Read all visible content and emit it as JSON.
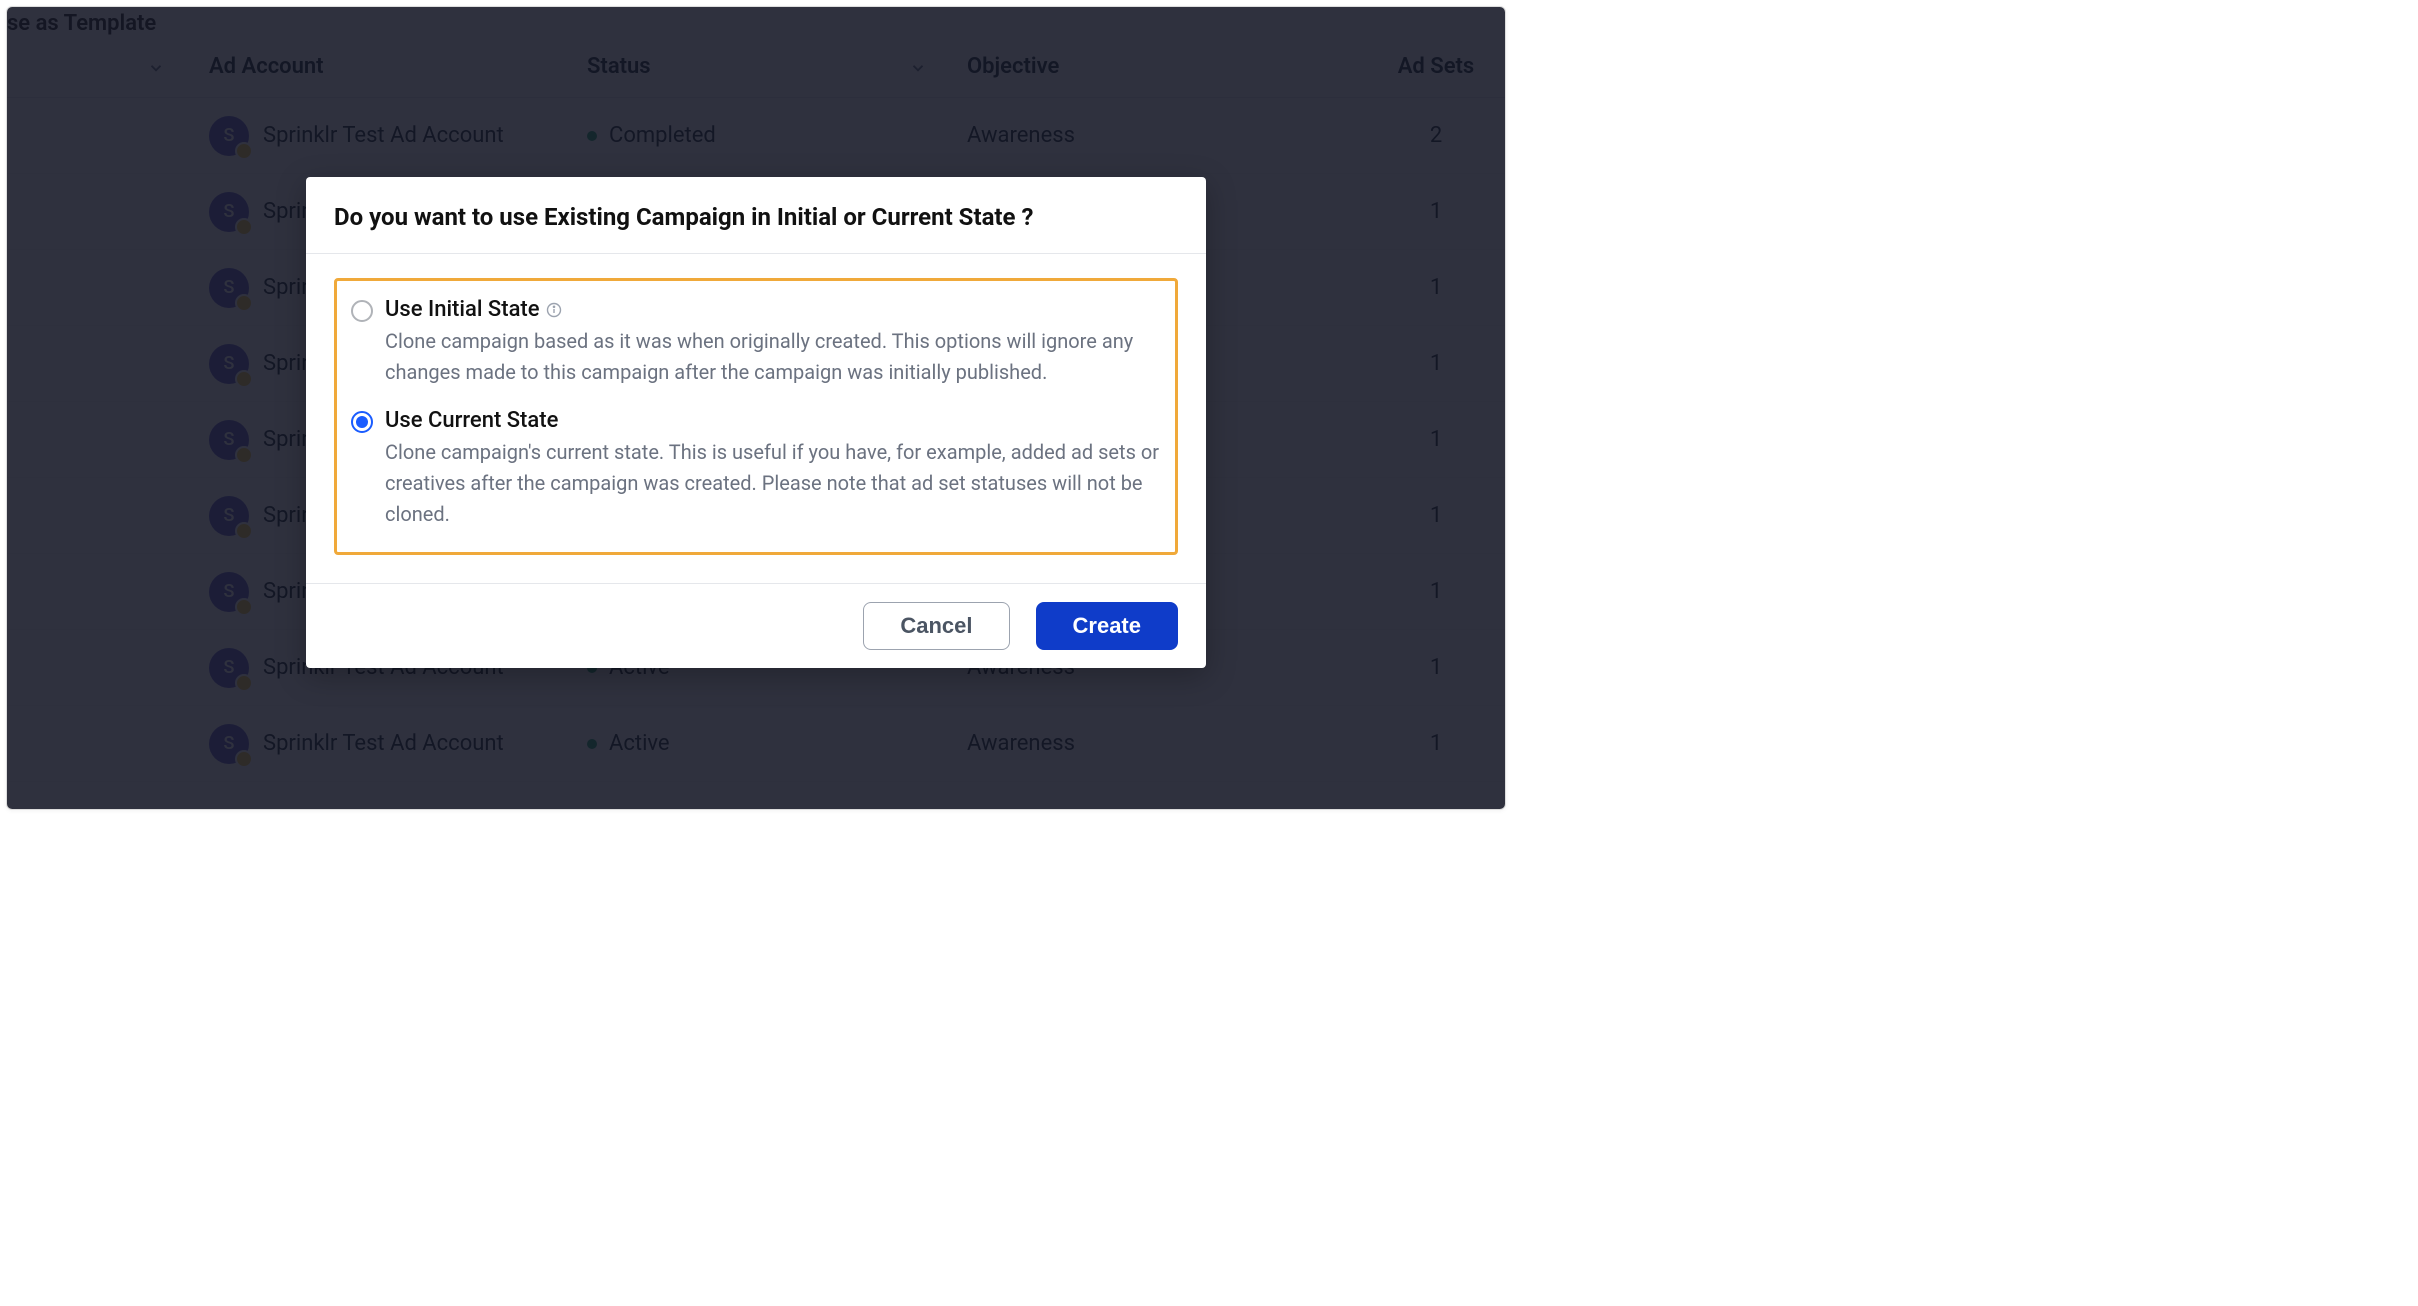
{
  "truncated_header": "se as Template",
  "table": {
    "columns": {
      "account": "Ad Account",
      "status": "Status",
      "objective": "Objective",
      "ad_sets": "Ad Sets"
    },
    "rows": [
      {
        "account": "Sprinklr Test Ad Account",
        "status": "Completed",
        "objective": "Awareness",
        "ad_sets": "2",
        "short": false
      },
      {
        "account": "Sprin",
        "status": "",
        "objective": "",
        "ad_sets": "1",
        "short": true
      },
      {
        "account": "Sprin",
        "status": "",
        "objective": "",
        "ad_sets": "1",
        "short": true
      },
      {
        "account": "Sprin",
        "status": "",
        "objective": "",
        "ad_sets": "1",
        "short": true
      },
      {
        "account": "Sprin",
        "status": "",
        "objective": "",
        "ad_sets": "1",
        "short": true
      },
      {
        "account": "Sprin",
        "status": "",
        "objective": "",
        "ad_sets": "1",
        "short": true
      },
      {
        "account": "Sprin",
        "status": "",
        "objective": "",
        "ad_sets": "1",
        "short": true
      },
      {
        "account": "Sprinklr Test Ad Account",
        "status": "Active",
        "objective": "Awareness",
        "ad_sets": "1",
        "short": false
      },
      {
        "account": "Sprinklr Test Ad Account",
        "status": "Active",
        "objective": "Awareness",
        "ad_sets": "1",
        "short": false
      }
    ],
    "avatar_letter": "S"
  },
  "modal": {
    "title": "Do you want to use Existing Campaign in Initial or Current State ?",
    "options": {
      "initial": {
        "label": "Use Initial State",
        "desc": "Clone campaign based as it was when originally created. This options will ignore any changes made to this campaign after the campaign was initially published."
      },
      "current": {
        "label": "Use Current State",
        "desc": "Clone campaign's current state. This is useful if you have, for example, added ad sets or creatives after the campaign was created. Please note that ad set statuses will not be cloned."
      }
    },
    "buttons": {
      "cancel": "Cancel",
      "create": "Create"
    }
  }
}
